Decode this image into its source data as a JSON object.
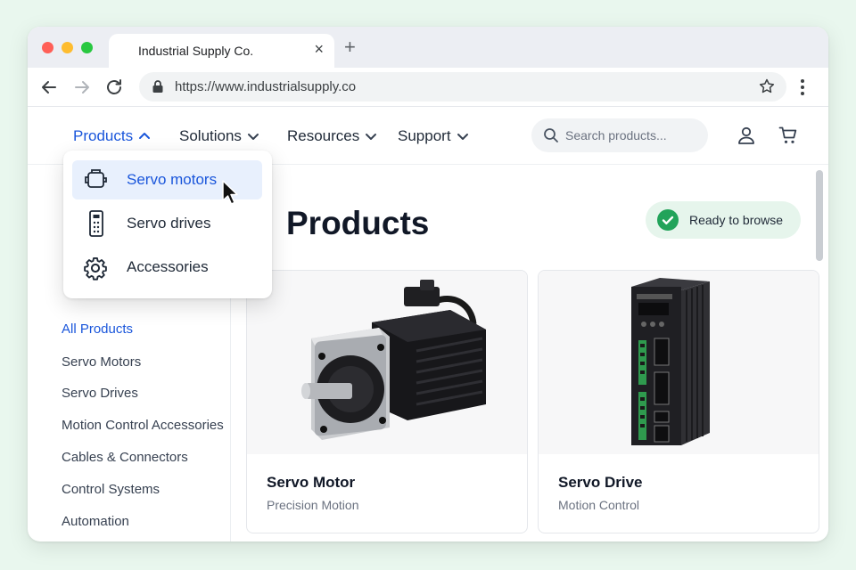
{
  "browser": {
    "tab_title": "Industrial Supply Co.",
    "tab_close": "×",
    "new_tab": "+",
    "url": "https://www.industrialsupply.co"
  },
  "nav": {
    "items": [
      {
        "label": "Products",
        "active": true,
        "expanded": true
      },
      {
        "label": "Solutions",
        "active": false,
        "expanded": false
      },
      {
        "label": "Resources",
        "active": false,
        "expanded": false
      },
      {
        "label": "Support",
        "active": false,
        "expanded": false
      }
    ],
    "search_placeholder": "Search products..."
  },
  "dropdown": {
    "items": [
      {
        "label": "Servo motors",
        "icon": "motor-icon",
        "hovered": true
      },
      {
        "label": "Servo drives",
        "icon": "drive-icon",
        "hovered": false
      },
      {
        "label": "Accessories",
        "icon": "gear-icon",
        "hovered": false
      }
    ]
  },
  "page": {
    "title_partial": "Products",
    "status": "Ready to browse"
  },
  "sidebar": {
    "items": [
      {
        "label": "All Products",
        "active": true
      },
      {
        "label": "Servo Motors",
        "active": false
      },
      {
        "label": "Servo Drives",
        "active": false
      },
      {
        "label": "Motion Control Accessories",
        "active": false
      },
      {
        "label": "Cables & Connectors",
        "active": false
      },
      {
        "label": "Control Systems",
        "active": false
      },
      {
        "label": "Automation",
        "active": false
      }
    ]
  },
  "products": [
    {
      "title": "Servo Motor",
      "subtitle": "Precision Motion"
    },
    {
      "title": "Servo Drive",
      "subtitle": "Motion Control"
    }
  ],
  "colors": {
    "accent": "#1a56db",
    "status_green": "#22a35a",
    "background": "#e9f7ee"
  }
}
